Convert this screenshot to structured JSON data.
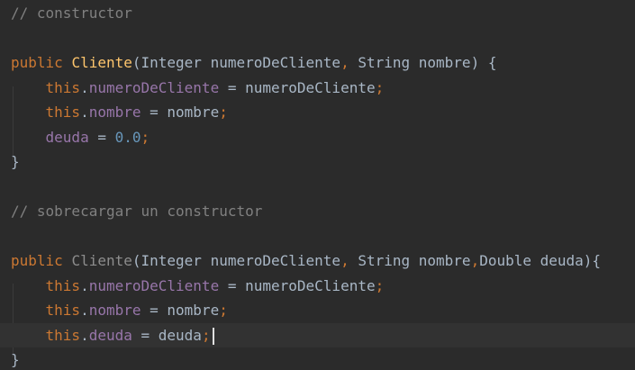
{
  "editor": {
    "lines": [
      [
        {
          "t": "// constructor",
          "k": "cm"
        }
      ],
      [],
      [
        {
          "t": "public",
          "k": "kw"
        },
        {
          "t": " ",
          "k": "txt"
        },
        {
          "t": "Cliente",
          "k": "fnd"
        },
        {
          "t": "(Integer numeroDeCliente",
          "k": "txt"
        },
        {
          "t": ",",
          "k": "pun"
        },
        {
          "t": " String nombre) {",
          "k": "txt"
        }
      ],
      [
        {
          "t": "    ",
          "k": "txt"
        },
        {
          "t": "this",
          "k": "kw"
        },
        {
          "t": ".",
          "k": "txt"
        },
        {
          "t": "numeroDeCliente",
          "k": "fld"
        },
        {
          "t": " = numeroDeCliente",
          "k": "txt"
        },
        {
          "t": ";",
          "k": "pun"
        }
      ],
      [
        {
          "t": "    ",
          "k": "txt"
        },
        {
          "t": "this",
          "k": "kw"
        },
        {
          "t": ".",
          "k": "txt"
        },
        {
          "t": "nombre",
          "k": "fld"
        },
        {
          "t": " = nombre",
          "k": "txt"
        },
        {
          "t": ";",
          "k": "pun"
        }
      ],
      [
        {
          "t": "    ",
          "k": "txt"
        },
        {
          "t": "deuda",
          "k": "fld"
        },
        {
          "t": " = ",
          "k": "txt"
        },
        {
          "t": "0.0",
          "k": "num"
        },
        {
          "t": ";",
          "k": "pun"
        }
      ],
      [
        {
          "t": "}",
          "k": "txt"
        }
      ],
      [],
      [
        {
          "t": "// sobrecargar un constructor",
          "k": "cm"
        }
      ],
      [],
      [
        {
          "t": "public",
          "k": "kw"
        },
        {
          "t": " ",
          "k": "txt"
        },
        {
          "t": "Cliente",
          "k": "fnu"
        },
        {
          "t": "(Integer numeroDeCliente",
          "k": "txt"
        },
        {
          "t": ",",
          "k": "pun"
        },
        {
          "t": " String nombre",
          "k": "txt"
        },
        {
          "t": ",",
          "k": "pun"
        },
        {
          "t": "Double deuda){",
          "k": "txt"
        }
      ],
      [
        {
          "t": "    ",
          "k": "txt"
        },
        {
          "t": "this",
          "k": "kw"
        },
        {
          "t": ".",
          "k": "txt"
        },
        {
          "t": "numeroDeCliente",
          "k": "fld"
        },
        {
          "t": " = numeroDeCliente",
          "k": "txt"
        },
        {
          "t": ";",
          "k": "pun"
        }
      ],
      [
        {
          "t": "    ",
          "k": "txt"
        },
        {
          "t": "this",
          "k": "kw"
        },
        {
          "t": ".",
          "k": "txt"
        },
        {
          "t": "nombre",
          "k": "fld"
        },
        {
          "t": " = nombre",
          "k": "txt"
        },
        {
          "t": ";",
          "k": "pun"
        }
      ],
      [
        {
          "t": "    ",
          "k": "txt"
        },
        {
          "t": "this",
          "k": "kw"
        },
        {
          "t": ".",
          "k": "txt"
        },
        {
          "t": "deuda",
          "k": "fld"
        },
        {
          "t": " = deuda",
          "k": "txt"
        },
        {
          "t": ";",
          "k": "pun"
        }
      ],
      [
        {
          "t": "}",
          "k": "txt"
        }
      ]
    ],
    "current_line": 13,
    "colors": {
      "background": "#2b2b2b",
      "current_line": "#323232",
      "comment": "#808080",
      "keyword": "#cc7832",
      "method_declaration": "#ffc66d",
      "method_unused": "#8d8d8d",
      "field": "#9876aa",
      "number": "#6897bb",
      "text": "#a9b7c6"
    }
  }
}
